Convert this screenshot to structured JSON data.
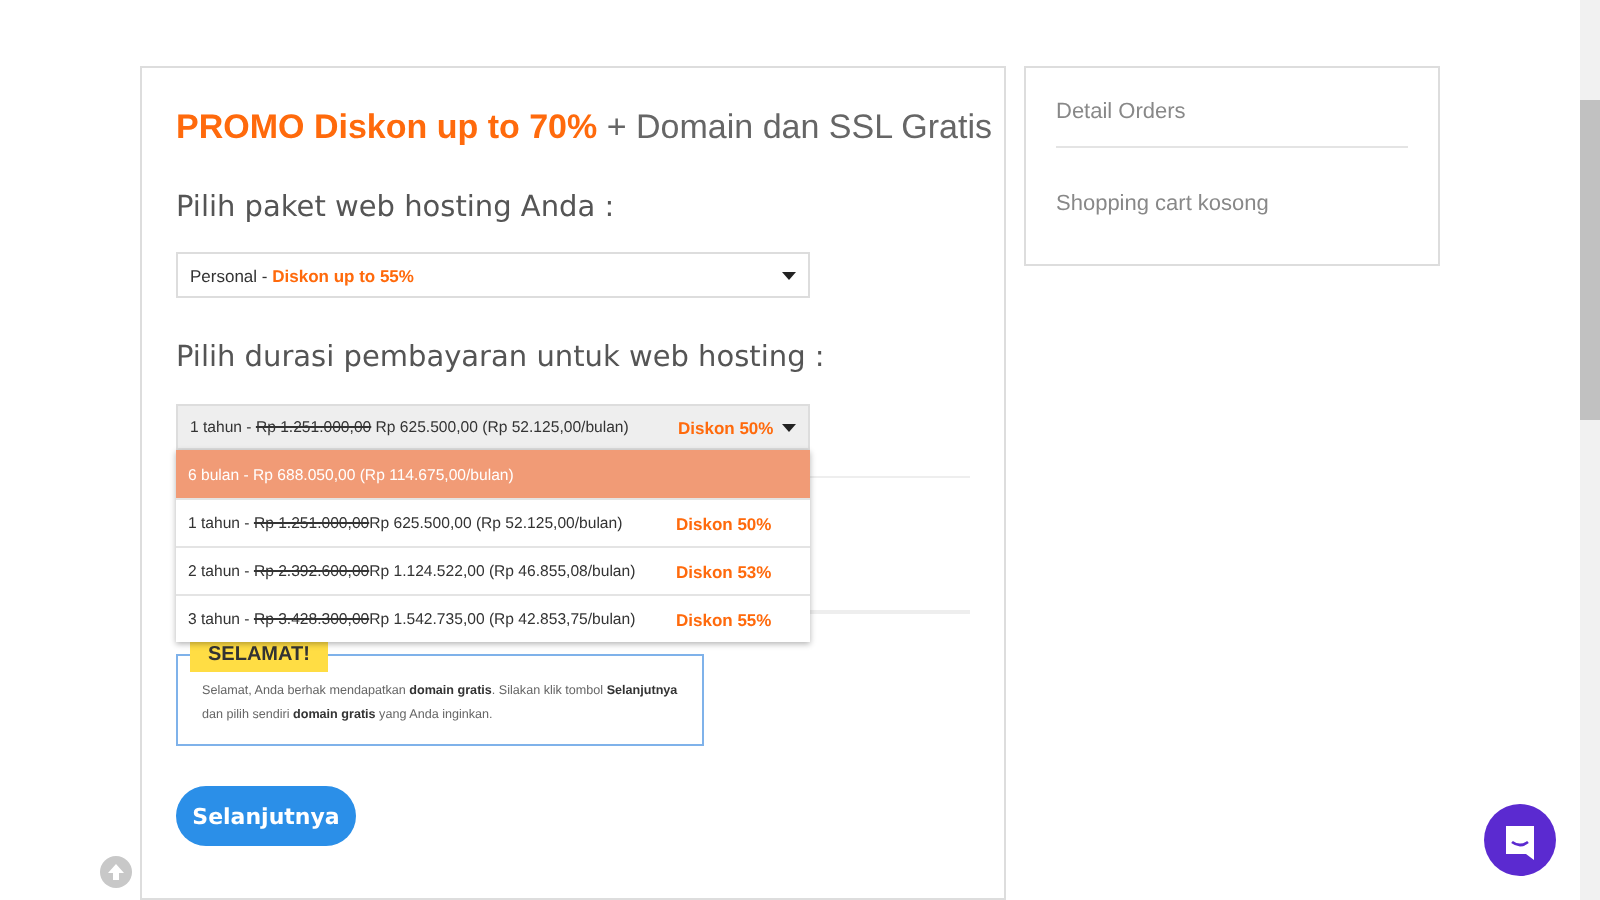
{
  "promo": {
    "highlight": "PROMO Diskon up to 70%",
    "rest": "+ Domain dan SSL Gratis"
  },
  "package": {
    "label": "Pilih paket web hosting Anda :",
    "value": "Personal -",
    "discount": "Diskon up to 55%"
  },
  "duration": {
    "label": "Pilih durasi pembayaran untuk web hosting :",
    "expanded": true,
    "value": {
      "period": "1 tahun -",
      "old_price": "Rp 1.251.000,00",
      "price": "Rp 625.500,00 (Rp 52.125,00/bulan)",
      "discount": "Diskon 50%"
    },
    "options": [
      {
        "period": "6 bulan -",
        "price": "Rp 688.050,00 (Rp 114.675,00/bulan)",
        "selected": true
      },
      {
        "period": "1 tahun -",
        "old_price": "Rp 1.251.000,00",
        "price": "Rp 625.500,00 (Rp 52.125,00/bulan)",
        "discount": "Diskon 50%",
        "selected": false
      },
      {
        "period": "2 tahun -",
        "old_price": "Rp 2.392.600,00",
        "price": "Rp 1.124.522,00 (Rp 46.855,08/bulan)",
        "discount": "Diskon 53%",
        "selected": false
      },
      {
        "period": "3 tahun -",
        "old_price": "Rp 3.428.300,00",
        "price": "Rp 1.542.735,00 (Rp 42.853,75/bulan)",
        "discount": "Diskon 55%",
        "selected": false
      }
    ]
  },
  "congrats": {
    "badge": "SELAMAT!",
    "message": "Selamat, Anda berhak mendapatkan **domain gratis**. Silakan klik tombol **Selanjutnya** dan pilih sendiri **domain gratis** yang Anda inginkan."
  },
  "next_button": "Selanjutnya",
  "sidebar": {
    "title": "Detail Orders",
    "empty_text": "Shopping cart kosong"
  }
}
